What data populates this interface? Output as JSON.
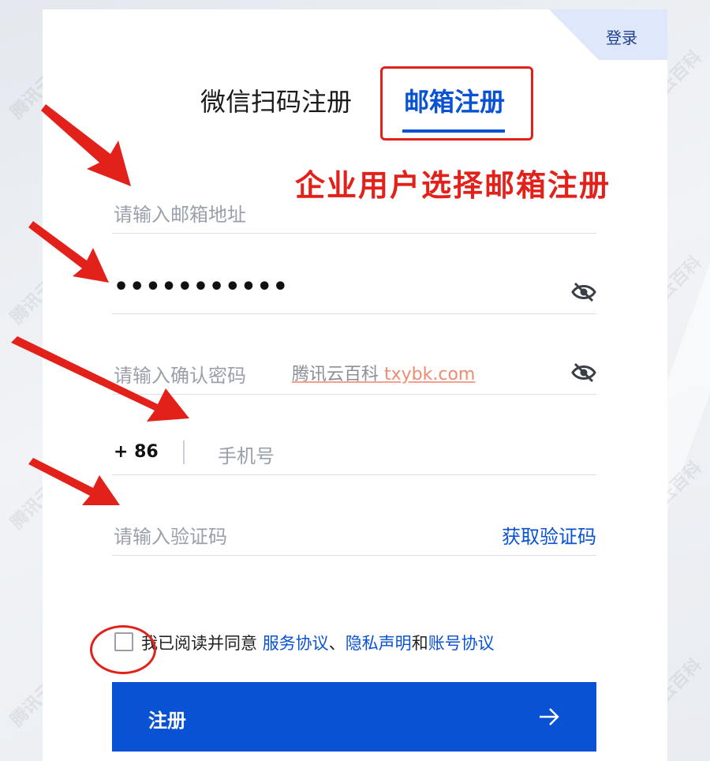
{
  "header": {
    "login_label": "登录"
  },
  "tabs": [
    {
      "label": "微信扫码注册",
      "active": false
    },
    {
      "label": "邮箱注册",
      "active": true
    }
  ],
  "annotation": {
    "text": "企业用户选择邮箱注册",
    "color": "#e3211b"
  },
  "form": {
    "email_placeholder": "请输入邮箱地址",
    "password_value": "•••••••••••",
    "confirm_placeholder": "请输入确认密码",
    "country_code": "+ 86",
    "phone_placeholder": "手机号",
    "code_placeholder": "请输入验证码",
    "get_code_label": "获取验证码"
  },
  "overlay_watermark": {
    "site": "腾讯云百科",
    "url": "txybk.com"
  },
  "agreement": {
    "prefix": "我已阅读并同意 ",
    "service": "服务协议",
    "sep": "、",
    "privacy": "隐私声明",
    "and": "和",
    "account": "账号协议"
  },
  "submit": {
    "label": "注册"
  },
  "colors": {
    "accent": "#0a52d4",
    "annotation_red": "#e3211b"
  },
  "watermark_text": "腾讯云百科"
}
